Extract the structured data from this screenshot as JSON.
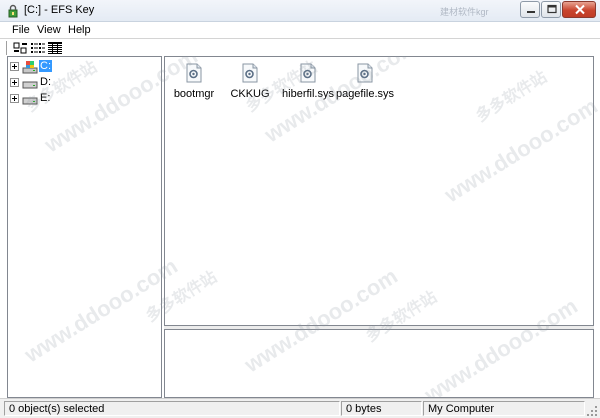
{
  "window": {
    "title": "[C:] - EFS Key",
    "icon": "efs-key-app-icon",
    "ghost_text": "建材软件kgr",
    "controls": [
      "minimize-icon",
      "maximize-icon",
      "close-icon"
    ]
  },
  "menu": {
    "file": "File",
    "view": "View",
    "help": "Help"
  },
  "toolbar": {
    "buttons": [
      "large-icons-view-icon",
      "list-view-icon",
      "details-view-icon"
    ]
  },
  "tree": {
    "drives": [
      {
        "label": "C:",
        "selected": true,
        "icon": "system-drive-icon"
      },
      {
        "label": "D:",
        "selected": false,
        "icon": "hard-drive-icon"
      },
      {
        "label": "E:",
        "selected": false,
        "icon": "hard-drive-icon"
      }
    ]
  },
  "files": [
    {
      "name": "bootmgr",
      "icon": "system-file-icon"
    },
    {
      "name": "CKKUG",
      "icon": "system-file-icon"
    },
    {
      "name": "hiberfil.sys",
      "icon": "system-file-icon"
    },
    {
      "name": "pagefile.sys",
      "icon": "system-file-icon"
    }
  ],
  "status": {
    "selection": "0 object(s) selected",
    "size": "0 bytes",
    "location": "My Computer"
  },
  "watermark": {
    "text1": "www.ddooo.com",
    "text2": "多多软件站"
  },
  "colors": {
    "selection": "#3399ff",
    "close_button": "#c9452e",
    "pane_border": "#828790"
  }
}
